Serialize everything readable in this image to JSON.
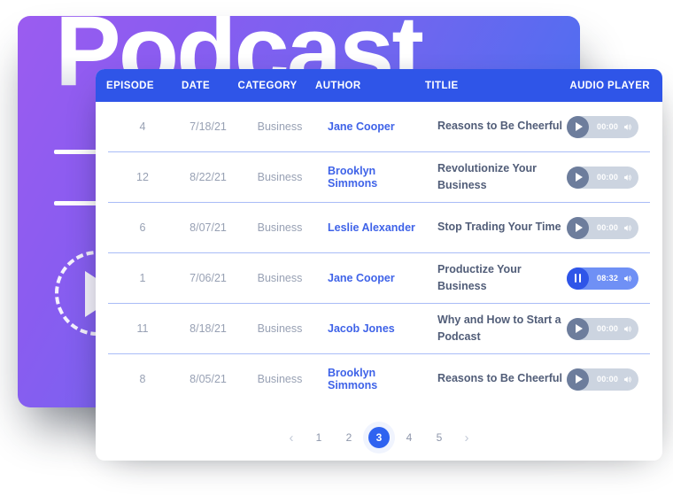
{
  "hero": {
    "title": "Podcast",
    "play_icon": "play-triangle-icon"
  },
  "table": {
    "columns": [
      {
        "key": "episode",
        "label": "EPISODE"
      },
      {
        "key": "date",
        "label": "DATE"
      },
      {
        "key": "category",
        "label": "CATEGORY"
      },
      {
        "key": "author",
        "label": "AUTHOR"
      },
      {
        "key": "title",
        "label": "TITLIE"
      },
      {
        "key": "player",
        "label": "AUDIO PLAYER"
      }
    ],
    "rows": [
      {
        "episode": "4",
        "date": "7/18/21",
        "category": "Business",
        "author": "Jane Cooper",
        "title": "Reasons to Be Cheerful",
        "player": {
          "state": "paused",
          "time": "00:00"
        }
      },
      {
        "episode": "12",
        "date": "8/22/21",
        "category": "Business",
        "author": "Brooklyn Simmons",
        "title": "Revolutionize Your Business",
        "player": {
          "state": "paused",
          "time": "00:00"
        }
      },
      {
        "episode": "6",
        "date": "8/07/21",
        "category": "Business",
        "author": "Leslie Alexander",
        "title": "Stop Trading Your Time",
        "player": {
          "state": "paused",
          "time": "00:00"
        }
      },
      {
        "episode": "1",
        "date": "7/06/21",
        "category": "Business",
        "author": "Jane Cooper",
        "title": "Productize Your Business",
        "player": {
          "state": "playing",
          "time": "08:32"
        }
      },
      {
        "episode": "11",
        "date": "8/18/21",
        "category": "Business",
        "author": "Jacob Jones",
        "title": "Why and How to Start a Podcast",
        "player": {
          "state": "paused",
          "time": "00:00"
        }
      },
      {
        "episode": "8",
        "date": "8/05/21",
        "category": "Business",
        "author": "Brooklyn Simmons",
        "title": "Reasons to Be Cheerful",
        "player": {
          "state": "paused",
          "time": "00:00"
        }
      }
    ]
  },
  "pagination": {
    "prev_label": "‹",
    "next_label": "›",
    "pages": [
      "1",
      "2",
      "3",
      "4",
      "5"
    ],
    "active_page": "3"
  },
  "colors": {
    "header_blue": "#2f55e8",
    "author_blue": "#3f63e8",
    "divider_blue": "#a9bcf7",
    "player_idle": "#ccd4e0",
    "player_active": "#6f90f5",
    "knob_idle": "#6d7d9c",
    "hero_purple": "#9b5cf0",
    "hero_blue": "#3f73f2"
  }
}
